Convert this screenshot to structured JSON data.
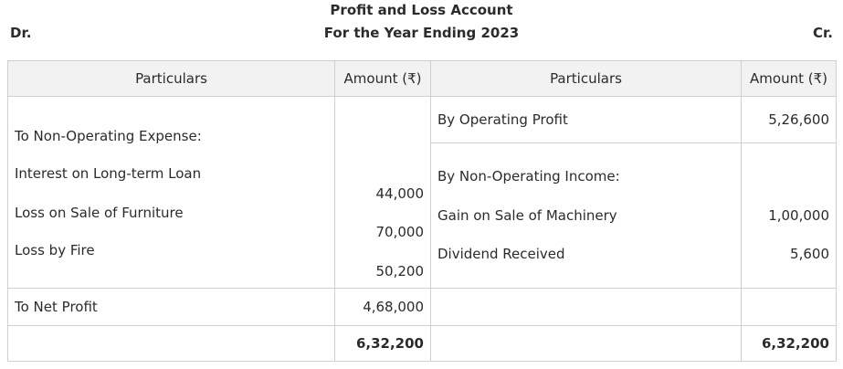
{
  "header": {
    "title": "Profit and Loss Account",
    "subtitle": "For the Year Ending 2023",
    "dr_label": "Dr.",
    "cr_label": "Cr."
  },
  "table": {
    "columns": [
      "Particulars",
      "Amount (₹)",
      "Particulars",
      "Amount (₹)"
    ],
    "debit": {
      "heading": "To Non-Operating Expense:",
      "items": [
        {
          "label": "Interest on Long-term Loan",
          "amount": "44,000"
        },
        {
          "label": "Loss on Sale of Furniture",
          "amount": "70,000"
        },
        {
          "label": "Loss by Fire",
          "amount": "50,200"
        }
      ],
      "net_profit_label": "To Net Profit",
      "net_profit_amount": "4,68,000",
      "total": "6,32,200"
    },
    "credit": {
      "operating_profit_label": "By Operating Profit",
      "operating_profit_amount": "5,26,600",
      "heading": "By Non-Operating Income:",
      "items": [
        {
          "label": "Gain on Sale of Machinery",
          "amount": "1,00,000"
        },
        {
          "label": "Dividend Received",
          "amount": "5,600"
        }
      ],
      "total": "6,32,200"
    }
  }
}
